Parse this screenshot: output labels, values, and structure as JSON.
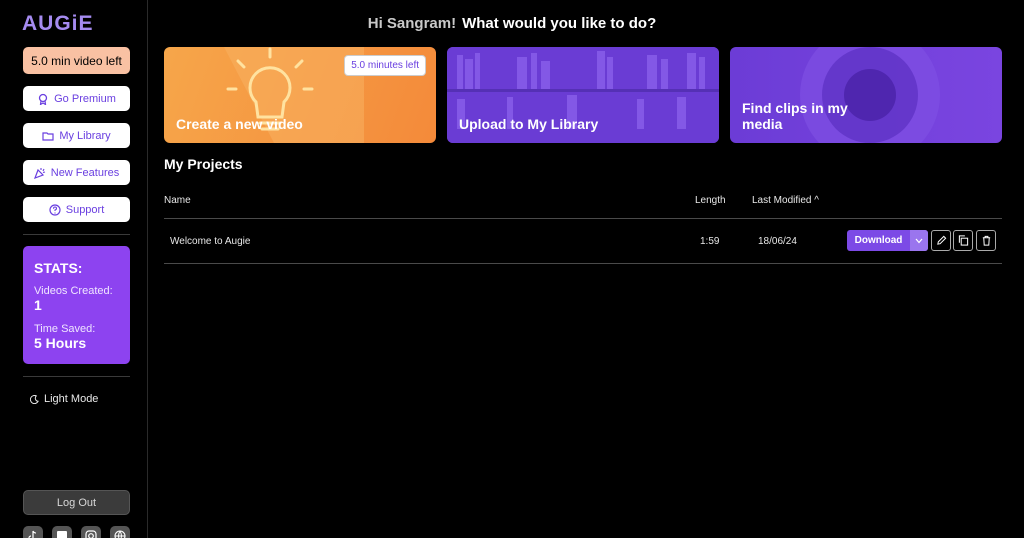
{
  "brand": {
    "logo": "AUGiE"
  },
  "greeting": {
    "hi": "Hi Sangram!",
    "question": "What would you like to do?"
  },
  "sidebar": {
    "minutes_left": "5.0 min video left",
    "nav": [
      {
        "label": "Go Premium",
        "icon": "premium-icon"
      },
      {
        "label": "My Library",
        "icon": "folder-icon"
      },
      {
        "label": "New Features",
        "icon": "party-icon"
      },
      {
        "label": "Support",
        "icon": "help-icon"
      }
    ],
    "stats": {
      "heading": "STATS:",
      "videos_label": "Videos Created:",
      "videos_value": "1",
      "time_label": "Time Saved:",
      "time_value": "5 Hours"
    },
    "light_mode": "Light Mode",
    "logout": "Log Out",
    "socials": [
      "tiktok-icon",
      "linkedin-icon",
      "instagram-icon",
      "globe-icon"
    ]
  },
  "cards": {
    "create": {
      "title": "Create a new video",
      "badge": "5.0 minutes left"
    },
    "upload": {
      "title": "Upload to My Library"
    },
    "find": {
      "title": "Find clips in my media"
    }
  },
  "projects": {
    "title": "My Projects",
    "columns": {
      "name": "Name",
      "length": "Length",
      "modified": "Last Modified ^"
    },
    "rows": [
      {
        "name": "Welcome to Augie",
        "length": "1:59",
        "modified": "18/06/24",
        "action": "Download"
      }
    ]
  },
  "colors": {
    "accent": "#8d43f0",
    "orange": "#f48a3a",
    "peach": "#f9c1a3"
  }
}
